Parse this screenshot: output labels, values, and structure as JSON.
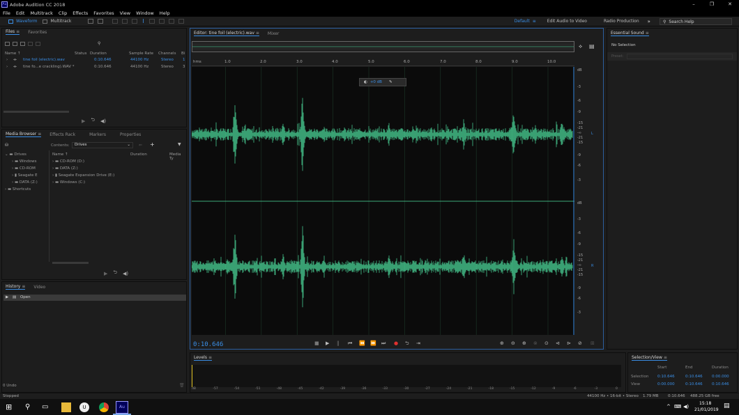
{
  "window": {
    "title": "Adobe Audition CC 2018",
    "app_icon": "Au"
  },
  "menu": [
    "File",
    "Edit",
    "Multitrack",
    "Clip",
    "Effects",
    "Favorites",
    "View",
    "Window",
    "Help"
  ],
  "toolbar": {
    "waveform": "Waveform",
    "multitrack": "Multitrack",
    "workspaces": [
      "Default",
      "Edit Audio to Video",
      "Radio Production"
    ],
    "more": "»",
    "search_placeholder": "Search Help"
  },
  "files_panel": {
    "tabs": [
      "Files",
      "Favorites"
    ],
    "columns": [
      "Name",
      "Status",
      "Duration",
      "Sample Rate",
      "Channels",
      "Bi"
    ],
    "files": [
      {
        "name": "tine foil (electric).wav",
        "duration": "0:10.646",
        "sample_rate": "44100 Hz",
        "channels": "Stereo",
        "bits": "1"
      },
      {
        "name": "tine fo...e crackling).WAV *",
        "duration": "0:10.646",
        "sample_rate": "44100 Hz",
        "channels": "Stereo",
        "bits": "3"
      }
    ]
  },
  "media_browser": {
    "tabs": [
      "Media Browser",
      "Effects Rack",
      "Markers",
      "Properties"
    ],
    "contents_label": "Contents:",
    "contents_value": "Drives",
    "tree": [
      "Drives",
      "Windows",
      "CD-ROM",
      "Seagate E",
      "DATA (Z:)",
      "Shortcuts"
    ],
    "list_columns": [
      "Name",
      "Duration",
      "Media Ty"
    ],
    "list": [
      "CD-ROM (D:)",
      "DATA (Z:)",
      "Seagate Expansion Drive (E:)",
      "Windows (C:)"
    ]
  },
  "history_panel": {
    "tabs": [
      "History",
      "Video"
    ],
    "items": [
      "Open"
    ],
    "undo_count": "0 Undo"
  },
  "editor": {
    "tab_label": "Editor: tine foil (electric).wav",
    "mixer_tab": "Mixer",
    "ruler_unit": "hms",
    "ruler_ticks": [
      "1.0",
      "2.0",
      "3.0",
      "4.0",
      "5.0",
      "6.0",
      "7.0",
      "8.0",
      "9.0",
      "10.0"
    ],
    "gain_label": "+0 dB",
    "db_top": [
      "dB",
      "-3",
      "-6",
      "-9",
      "-15",
      "-21",
      "-∞",
      "-21",
      "-15",
      "-9",
      "-6",
      "-3"
    ],
    "db_bottom": [
      "dB",
      "-3",
      "-6",
      "-9",
      "-15",
      "-21",
      "-∞",
      "-21",
      "-15",
      "-9",
      "-6",
      "-3"
    ],
    "channel_left": "L",
    "channel_right": "R",
    "current_time": "0:10.646",
    "waveform_color": "#4ee0a0"
  },
  "essential_sound": {
    "title": "Essential Sound",
    "selection": "No Selection",
    "preset_label": "Preset:"
  },
  "levels": {
    "title": "Levels",
    "scale": [
      "dB",
      "-57",
      "-54",
      "-51",
      "-48",
      "-45",
      "-42",
      "-39",
      "-36",
      "-33",
      "-30",
      "-27",
      "-24",
      "-21",
      "-18",
      "-15",
      "-12",
      "-9",
      "-6",
      "-3",
      "0"
    ]
  },
  "selection_view": {
    "title": "Selection/View",
    "headers": [
      "Start",
      "End",
      "Duration"
    ],
    "selection": {
      "label": "Selection",
      "start": "0:10.646",
      "end": "0:10.646",
      "duration": "0:00.000"
    },
    "view": {
      "label": "View",
      "start": "0:00.000",
      "end": "0:10.646",
      "duration": "0:10.646"
    }
  },
  "status_bar": {
    "state": "Stopped",
    "info": "44100 Hz • 16-bit • Stereo",
    "size": "1.79 MB",
    "duration": "0:10.646",
    "free": "488.25 GB free"
  },
  "taskbar": {
    "time": "15:18",
    "date": "21/01/2019"
  }
}
